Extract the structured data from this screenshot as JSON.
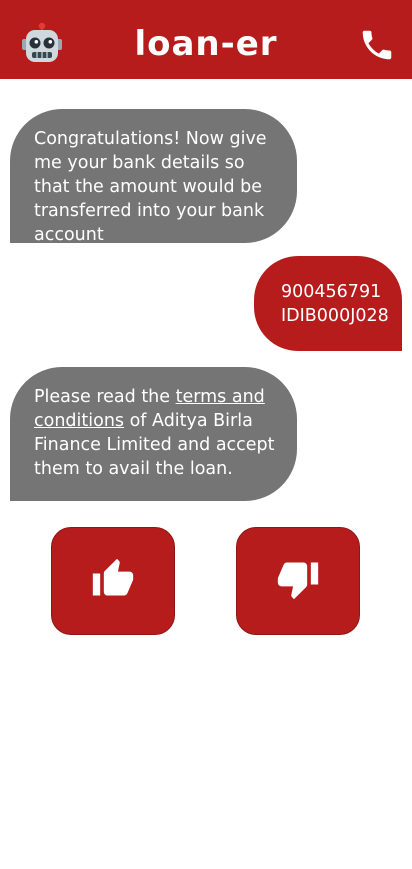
{
  "header": {
    "brand": "loan-er",
    "avatar_icon": "robot-icon",
    "call_icon": "phone-icon",
    "background": "#b71c1c"
  },
  "chat": {
    "messages": [
      {
        "sender": "bot",
        "text": "Congratulations! Now give me your bank details so that the amount would be transferred into your bank account"
      },
      {
        "sender": "user",
        "lines": [
          "900456791",
          "IDIB000J028"
        ]
      },
      {
        "sender": "bot",
        "before": "Please read the ",
        "link": "terms and conditions",
        "after": " of Aditya Birla Finance Limited and accept them to avail the loan."
      }
    ]
  },
  "actions": {
    "accept_icon": "thumbs-up-icon",
    "reject_icon": "thumbs-down-icon"
  },
  "colors": {
    "accent": "#b71c1c",
    "bot_bubble": "#757575",
    "text_on_bubble": "#ffffff"
  }
}
